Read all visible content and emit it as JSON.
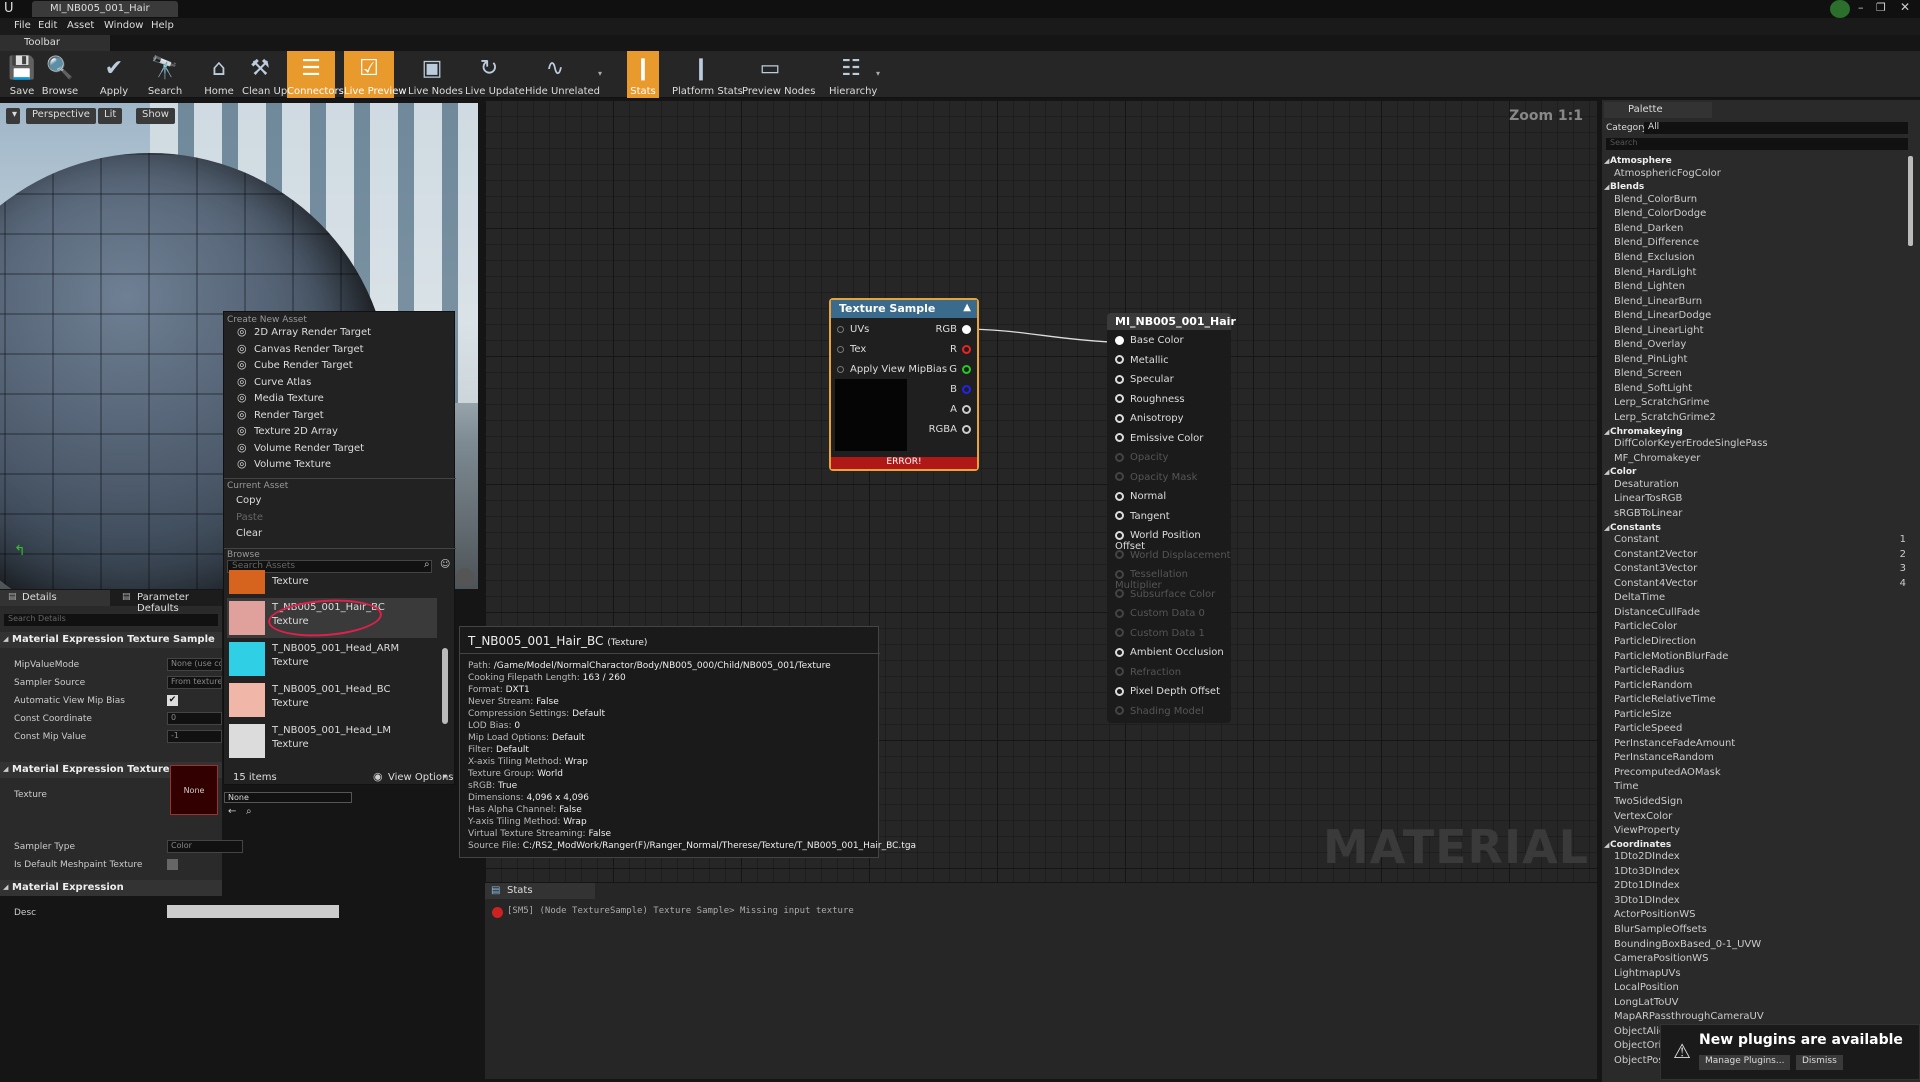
{
  "window": {
    "tab_title": "MI_NB005_001_Hair"
  },
  "menu": [
    "File",
    "Edit",
    "Asset",
    "Window",
    "Help"
  ],
  "toolbar_tab": "Toolbar",
  "toolbar": [
    {
      "label": "Save",
      "icon": "save-icon",
      "glyph": "💾"
    },
    {
      "label": "Browse",
      "icon": "browse-icon",
      "glyph": "🔍"
    },
    {
      "label": "Apply",
      "icon": "apply-icon",
      "glyph": "✔"
    },
    {
      "label": "Search",
      "icon": "search-icon",
      "glyph": "🔭"
    },
    {
      "label": "Home",
      "icon": "home-icon",
      "glyph": "⌂"
    },
    {
      "label": "Clean Up",
      "icon": "clean-up-icon",
      "glyph": "⚒"
    },
    {
      "label": "Connectors",
      "icon": "connectors-icon",
      "glyph": "☰",
      "active": true
    },
    {
      "label": "Live Preview",
      "icon": "live-preview-icon",
      "glyph": "☑",
      "active": true
    },
    {
      "label": "Live Nodes",
      "icon": "live-nodes-icon",
      "glyph": "▣"
    },
    {
      "label": "Live Update",
      "icon": "live-update-icon",
      "glyph": "↻"
    },
    {
      "label": "Hide Unrelated",
      "icon": "hide-unrelated-icon",
      "glyph": "∿"
    },
    {
      "label": "Stats",
      "icon": "stats-icon",
      "glyph": "❙",
      "active": true
    },
    {
      "label": "Platform Stats",
      "icon": "platform-stats-icon",
      "glyph": "❙"
    },
    {
      "label": "Preview Nodes",
      "icon": "preview-nodes-icon",
      "glyph": "▭"
    },
    {
      "label": "Hierarchy",
      "icon": "hierarchy-icon",
      "glyph": "☷"
    }
  ],
  "viewport": {
    "buttons": [
      "Perspective",
      "Lit",
      "Show"
    ]
  },
  "graph": {
    "zoom": "Zoom 1:1",
    "watermark": "MATERIAL"
  },
  "texture_sample": {
    "title": "Texture Sample",
    "inputs": [
      "UVs",
      "Tex",
      "Apply View MipBias"
    ],
    "outputs": [
      "RGB",
      "R",
      "G",
      "B",
      "A",
      "RGBA"
    ],
    "error": "ERROR!"
  },
  "material_node": {
    "title": "MI_NB005_001_Hair",
    "pins": [
      {
        "label": "Base Color",
        "enabled": true
      },
      {
        "label": "Metallic",
        "enabled": true
      },
      {
        "label": "Specular",
        "enabled": true
      },
      {
        "label": "Roughness",
        "enabled": true
      },
      {
        "label": "Anisotropy",
        "enabled": true
      },
      {
        "label": "Emissive Color",
        "enabled": true
      },
      {
        "label": "Opacity",
        "enabled": false
      },
      {
        "label": "Opacity Mask",
        "enabled": false
      },
      {
        "label": "Normal",
        "enabled": true
      },
      {
        "label": "Tangent",
        "enabled": true
      },
      {
        "label": "World Position Offset",
        "enabled": true
      },
      {
        "label": "World Displacement",
        "enabled": false
      },
      {
        "label": "Tessellation Multiplier",
        "enabled": false
      },
      {
        "label": "Subsurface Color",
        "enabled": false
      },
      {
        "label": "Custom Data 0",
        "enabled": false
      },
      {
        "label": "Custom Data 1",
        "enabled": false
      },
      {
        "label": "Ambient Occlusion",
        "enabled": true
      },
      {
        "label": "Refraction",
        "enabled": false
      },
      {
        "label": "Pixel Depth Offset",
        "enabled": true
      },
      {
        "label": "Shading Model",
        "enabled": false
      }
    ]
  },
  "context_menu": {
    "create_header": "Create New Asset",
    "create_items": [
      "2D Array Render Target",
      "Canvas Render Target",
      "Cube Render Target",
      "Curve Atlas",
      "Media Texture",
      "Render Target",
      "Texture 2D Array",
      "Volume Render Target",
      "Volume Texture"
    ],
    "current_header": "Current Asset",
    "current_items": [
      "Copy",
      "Paste",
      "Clear"
    ],
    "browse_header": "Browse",
    "search_placeholder": "Search Assets",
    "assets": [
      {
        "name": "",
        "type": "Texture",
        "color": "#d6641e"
      },
      {
        "name": "T_NB005_001_Hair_BC",
        "type": "Texture",
        "color": "#e0a19c"
      },
      {
        "name": "T_NB005_001_Head_ARM",
        "type": "Texture",
        "color": "#2fd0e6"
      },
      {
        "name": "T_NB005_001_Head_BC",
        "type": "Texture",
        "color": "#f0b6a8"
      },
      {
        "name": "T_NB005_001_Head_LM",
        "type": "Texture",
        "color": "#dcdcdc"
      }
    ],
    "count": "15 items",
    "view_options": "View Options"
  },
  "tooltip": {
    "title": "T_NB005_001_Hair_BC",
    "title_suffix": "(Texture)",
    "lines": [
      {
        "k": "Path:",
        "v": "/Game/Model/NormalCharactor/Body/NB005_000/Child/NB005_001/Texture"
      },
      {
        "k": "Cooking Filepath Length:",
        "v": "163 / 260"
      },
      {
        "k": "Format:",
        "v": "DXT1"
      },
      {
        "k": "Never Stream:",
        "v": "False"
      },
      {
        "k": "Compression Settings:",
        "v": "Default"
      },
      {
        "k": "LOD Bias:",
        "v": "0"
      },
      {
        "k": "Mip Load Options:",
        "v": "Default"
      },
      {
        "k": "Filter:",
        "v": "Default"
      },
      {
        "k": "X-axis Tiling Method:",
        "v": "Wrap"
      },
      {
        "k": "Texture Group:",
        "v": "World"
      },
      {
        "k": "sRGB:",
        "v": "True"
      },
      {
        "k": "Dimensions:",
        "v": "4,096 x 4,096"
      },
      {
        "k": "Has Alpha Channel:",
        "v": "False"
      },
      {
        "k": "Y-axis Tiling Method:",
        "v": "Wrap"
      },
      {
        "k": "Virtual Texture Streaming:",
        "v": "False"
      },
      {
        "k": "Source File:",
        "v": "C:/RS2_ModWork/Ranger(F)/Ranger_Normal/Therese/Texture/T_NB005_001_Hair_BC.tga"
      }
    ]
  },
  "details": {
    "tabs": [
      "Details",
      "Parameter Defaults"
    ],
    "search_placeholder": "Search Details",
    "sections": [
      {
        "title": "Material Expression Texture Sample",
        "rows": [
          {
            "k": "MipValueMode",
            "v": "None (use com"
          },
          {
            "k": "Sampler Source",
            "v": "From texture a"
          },
          {
            "k": "Automatic View Mip Bias",
            "v": "✔"
          },
          {
            "k": "Const Coordinate",
            "v": "0"
          },
          {
            "k": "Const Mip Value",
            "v": "-1"
          }
        ]
      },
      {
        "title": "Material Expression Texture Base",
        "rows": [
          {
            "k": "Texture",
            "v": "None"
          },
          {
            "k": "Sampler Type",
            "v": "Color"
          },
          {
            "k": "Is Default Meshpaint Texture",
            "v": ""
          }
        ]
      },
      {
        "title": "Material Expression",
        "rows": [
          {
            "k": "Desc",
            "v": ""
          }
        ]
      }
    ],
    "texture_thumb_label": "None",
    "texture_dropdown": "None"
  },
  "palette": {
    "tab": "Palette",
    "category_label": "Category:",
    "category_value": "All",
    "search_placeholder": "Search",
    "groups": [
      {
        "name": "Atmosphere",
        "items": [
          "AtmosphericFogColor"
        ]
      },
      {
        "name": "Blends",
        "items": [
          "Blend_ColorBurn",
          "Blend_ColorDodge",
          "Blend_Darken",
          "Blend_Difference",
          "Blend_Exclusion",
          "Blend_HardLight",
          "Blend_Lighten",
          "Blend_LinearBurn",
          "Blend_LinearDodge",
          "Blend_LinearLight",
          "Blend_Overlay",
          "Blend_PinLight",
          "Blend_Screen",
          "Blend_SoftLight",
          "Lerp_ScratchGrime",
          "Lerp_ScratchGrime2"
        ]
      },
      {
        "name": "Chromakeying",
        "items": [
          "DiffColorKeyerErodeSinglePass",
          "MF_Chromakeyer"
        ]
      },
      {
        "name": "Color",
        "items": [
          "Desaturation",
          "LinearTosRGB",
          "sRGBToLinear"
        ]
      },
      {
        "name": "Constants",
        "items": [
          "Constant",
          "Constant2Vector",
          "Constant3Vector",
          "Constant4Vector",
          "DeltaTime",
          "DistanceCullFade",
          "ParticleColor",
          "ParticleDirection",
          "ParticleMotionBlurFade",
          "ParticleRadius",
          "ParticleRandom",
          "ParticleRelativeTime",
          "ParticleSize",
          "ParticleSpeed",
          "PerInstanceFadeAmount",
          "PerInstanceRandom",
          "PrecomputedAOMask",
          "Time",
          "TwoSidedSign",
          "VertexColor",
          "ViewProperty"
        ],
        "keys": [
          "1",
          "2",
          "3",
          "4"
        ]
      },
      {
        "name": "Coordinates",
        "items": [
          "1Dto2DIndex",
          "1Dto3DIndex",
          "2Dto1DIndex",
          "3Dto1DIndex",
          "ActorPositionWS",
          "BlurSampleOffsets",
          "BoundingBoxBased_0-1_UVW",
          "CameraPositionWS",
          "LightmapUVs",
          "LocalPosition",
          "LongLatToUV",
          "MapARPassthroughCameraUV",
          "ObjectAlign",
          "ObjectOrie",
          "ObjectPosi"
        ]
      }
    ]
  },
  "stats": {
    "tab": "Stats",
    "message": "[SM5] (Node TextureSample) Texture Sample> Missing input texture"
  },
  "notification": {
    "text": "New plugins are available",
    "manage": "Manage Plugins...",
    "dismiss": "Dismiss"
  }
}
